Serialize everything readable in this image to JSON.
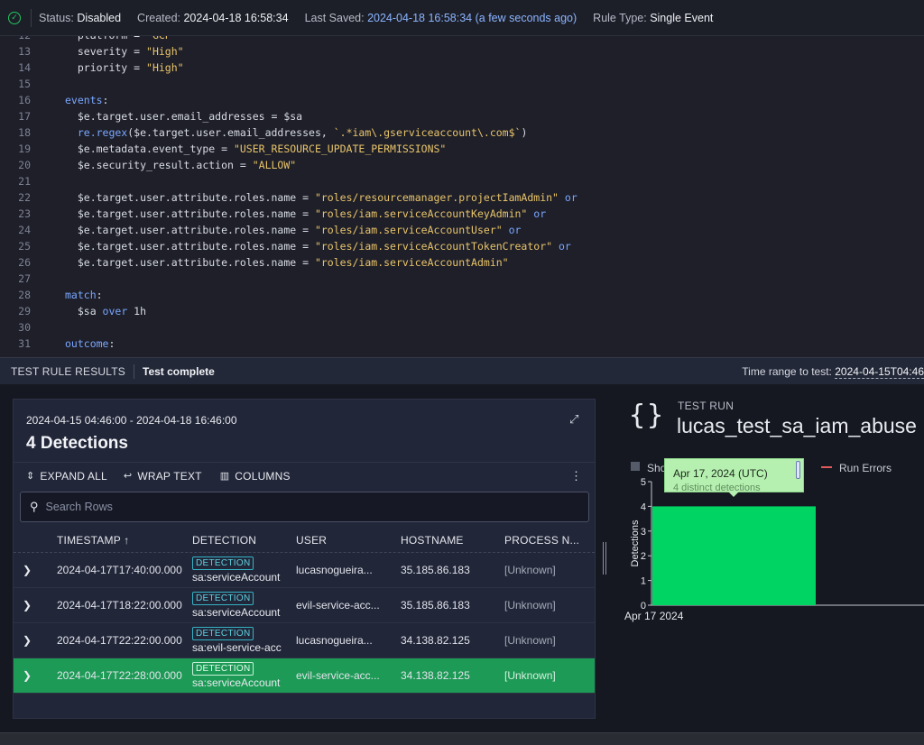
{
  "status": {
    "state_label": "Status:",
    "state_value": "Disabled",
    "created_label": "Created:",
    "created_value": "2024-04-18 16:58:34",
    "saved_label": "Last Saved:",
    "saved_value": "2024-04-18 16:58:34 (a few seconds ago)",
    "type_label": "Rule Type:",
    "type_value": "Single Event"
  },
  "code": [
    {
      "n": "13",
      "segs": [
        [
          "pl",
          "  severity = "
        ],
        [
          "str",
          "\"High\""
        ]
      ]
    },
    {
      "n": "14",
      "segs": [
        [
          "pl",
          "  priority = "
        ],
        [
          "str",
          "\"High\""
        ]
      ]
    },
    {
      "n": "15",
      "segs": []
    },
    {
      "n": "16",
      "segs": [
        [
          "kw",
          "events"
        ],
        [
          "pl",
          ":"
        ]
      ]
    },
    {
      "n": "17",
      "segs": [
        [
          "pl",
          "  $e.target.user.email_addresses = $sa"
        ]
      ]
    },
    {
      "n": "18",
      "segs": [
        [
          "fn",
          "  re.regex"
        ],
        [
          "pl",
          "($e.target.user.email_addresses, "
        ],
        [
          "str",
          "`.*iam\\.gserviceaccount\\.com$`"
        ],
        [
          "pl",
          ")"
        ]
      ]
    },
    {
      "n": "19",
      "segs": [
        [
          "pl",
          "  $e.metadata.event_type = "
        ],
        [
          "str",
          "\"USER_RESOURCE_UPDATE_PERMISSIONS\""
        ]
      ]
    },
    {
      "n": "20",
      "segs": [
        [
          "pl",
          "  $e.security_result.action = "
        ],
        [
          "str",
          "\"ALLOW\""
        ]
      ]
    },
    {
      "n": "21",
      "segs": []
    },
    {
      "n": "22",
      "segs": [
        [
          "pl",
          "  $e.target.user.attribute.roles.name = "
        ],
        [
          "str",
          "\"roles/resourcemanager.projectIamAdmin\""
        ],
        [
          "kw",
          " or"
        ]
      ]
    },
    {
      "n": "23",
      "segs": [
        [
          "pl",
          "  $e.target.user.attribute.roles.name = "
        ],
        [
          "str",
          "\"roles/iam.serviceAccountKeyAdmin\""
        ],
        [
          "kw",
          " or"
        ]
      ]
    },
    {
      "n": "24",
      "segs": [
        [
          "pl",
          "  $e.target.user.attribute.roles.name = "
        ],
        [
          "str",
          "\"roles/iam.serviceAccountUser\""
        ],
        [
          "kw",
          " or"
        ]
      ]
    },
    {
      "n": "25",
      "segs": [
        [
          "pl",
          "  $e.target.user.attribute.roles.name = "
        ],
        [
          "str",
          "\"roles/iam.serviceAccountTokenCreator\""
        ],
        [
          "kw",
          " or"
        ]
      ]
    },
    {
      "n": "26",
      "segs": [
        [
          "pl",
          "  $e.target.user.attribute.roles.name = "
        ],
        [
          "str",
          "\"roles/iam.serviceAccountAdmin\""
        ]
      ]
    },
    {
      "n": "27",
      "segs": []
    },
    {
      "n": "28",
      "segs": [
        [
          "kw",
          "match"
        ],
        [
          "pl",
          ":"
        ]
      ]
    },
    {
      "n": "29",
      "segs": [
        [
          "pl",
          "  $sa "
        ],
        [
          "kw",
          "over"
        ],
        [
          "pl",
          " 1h"
        ]
      ]
    },
    {
      "n": "30",
      "segs": []
    },
    {
      "n": "31",
      "segs": [
        [
          "kw",
          "outcome"
        ],
        [
          "pl",
          ":"
        ]
      ]
    }
  ],
  "results": {
    "title": "TEST RULE RESULTS",
    "state": "Test complete",
    "time_range_label": "Time range to test:",
    "time_range_value": "2024-04-15T04:46"
  },
  "panel": {
    "range": "2024-04-15 04:46:00 - 2024-04-18 16:46:00",
    "count": "4 Detections",
    "toolbar": {
      "expand": "EXPAND ALL",
      "wrap": "WRAP TEXT",
      "columns": "COLUMNS"
    },
    "search_placeholder": "Search Rows",
    "columns": [
      "TIMESTAMP ↑",
      "DETECTION",
      "USER",
      "HOSTNAME",
      "PROCESS N..."
    ],
    "rows": [
      {
        "timestamp": "2024-04-17T17:40:00.000",
        "badge": "DETECTION",
        "detection": "sa:serviceAccount",
        "user": "lucasnogueira...",
        "hostname": "35.185.86.183",
        "process": "[Unknown]",
        "selected": false
      },
      {
        "timestamp": "2024-04-17T18:22:00.000",
        "badge": "DETECTION",
        "detection": "sa:serviceAccount",
        "user": "evil-service-acc...",
        "hostname": "35.185.86.183",
        "process": "[Unknown]",
        "selected": false
      },
      {
        "timestamp": "2024-04-17T22:22:00.000",
        "badge": "DETECTION",
        "detection": "sa:evil-service-acc",
        "user": "lucasnogueira...",
        "hostname": "34.138.82.125",
        "process": "[Unknown]",
        "selected": false
      },
      {
        "timestamp": "2024-04-17T22:28:00.000",
        "badge": "DETECTION",
        "detection": "sa:serviceAccount",
        "user": "evil-service-acc...",
        "hostname": "34.138.82.125",
        "process": "[Unknown]",
        "selected": true
      }
    ]
  },
  "run": {
    "label": "TEST RUN",
    "name": "lucas_test_sa_iam_abuse",
    "legend_show": "Sho",
    "legend_errors": "Run Errors",
    "tooltip_date": "Apr 17, 2024 (UTC)",
    "tooltip_detail": "4 distinct detections"
  },
  "chart_data": {
    "type": "bar",
    "categories": [
      "Apr 17 2024"
    ],
    "values": [
      4
    ],
    "ylabel": "Detections",
    "ylim": [
      0,
      5
    ],
    "yticks": [
      0,
      1,
      2,
      3,
      4,
      5
    ],
    "bar_color": "#00d463"
  },
  "colors": {
    "accent_green": "#1d9a55",
    "badge_cyan": "#5fd3e3",
    "link_blue": "#8ab4ff"
  }
}
